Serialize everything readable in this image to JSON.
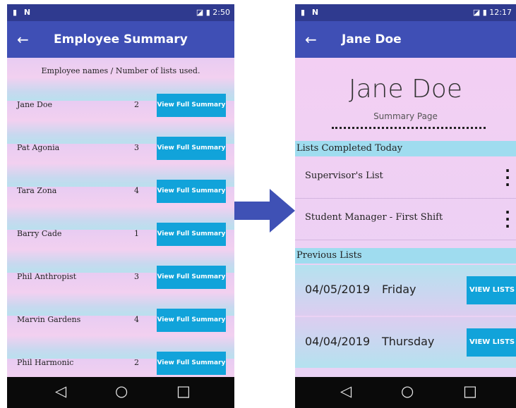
{
  "left": {
    "status": {
      "left": "▮ N",
      "right": "◪ ▮ 2:50"
    },
    "appbar": {
      "back": "←",
      "title": "Employee Summary"
    },
    "header": "Employee names / Number of lists used.",
    "employees": [
      {
        "name": "Jane Doe",
        "count": "2",
        "button": "View Full Summary"
      },
      {
        "name": "Pat Agonia",
        "count": "3",
        "button": "View Full Summary"
      },
      {
        "name": "Tara Zona",
        "count": "4",
        "button": "View Full Summary"
      },
      {
        "name": "Barry Cade",
        "count": "1",
        "button": "View Full Summary"
      },
      {
        "name": "Phil Anthropist",
        "count": "3",
        "button": "View Full Summary"
      },
      {
        "name": "Marvin Gardens",
        "count": "4",
        "button": "View Full Summary"
      },
      {
        "name": "Phil Harmonic",
        "count": "2",
        "button": "View Full Summary"
      }
    ],
    "nav": {
      "back": "◁",
      "home": "○",
      "recents": "□"
    }
  },
  "right": {
    "status": {
      "left": "▮ N",
      "right": "◪ ▮ 12:17"
    },
    "appbar": {
      "back": "←",
      "title": "Jane Doe"
    },
    "name": "Jane Doe",
    "subtitle": "Summary Page",
    "today_header": "Lists Completed Today",
    "today_lists": [
      {
        "label": "Supervisor's List",
        "menu": "⋮"
      },
      {
        "label": "Student Manager - First Shift",
        "menu": "⋮"
      }
    ],
    "previous_header": "Previous Lists",
    "previous_lists": [
      {
        "date": "04/05/2019",
        "day": "Friday",
        "button": "VIEW LISTS"
      },
      {
        "date": "04/04/2019",
        "day": "Thursday",
        "button": "VIEW LISTS"
      }
    ],
    "nav": {
      "back": "◁",
      "home": "○",
      "recents": "□"
    }
  },
  "colors": {
    "appbar": "#3f4fb5",
    "statusbar": "#2f3a8f",
    "button": "#11a3da",
    "arrow": "#3f51b5"
  },
  "icons": {
    "flow_arrow": "right-arrow-icon"
  }
}
